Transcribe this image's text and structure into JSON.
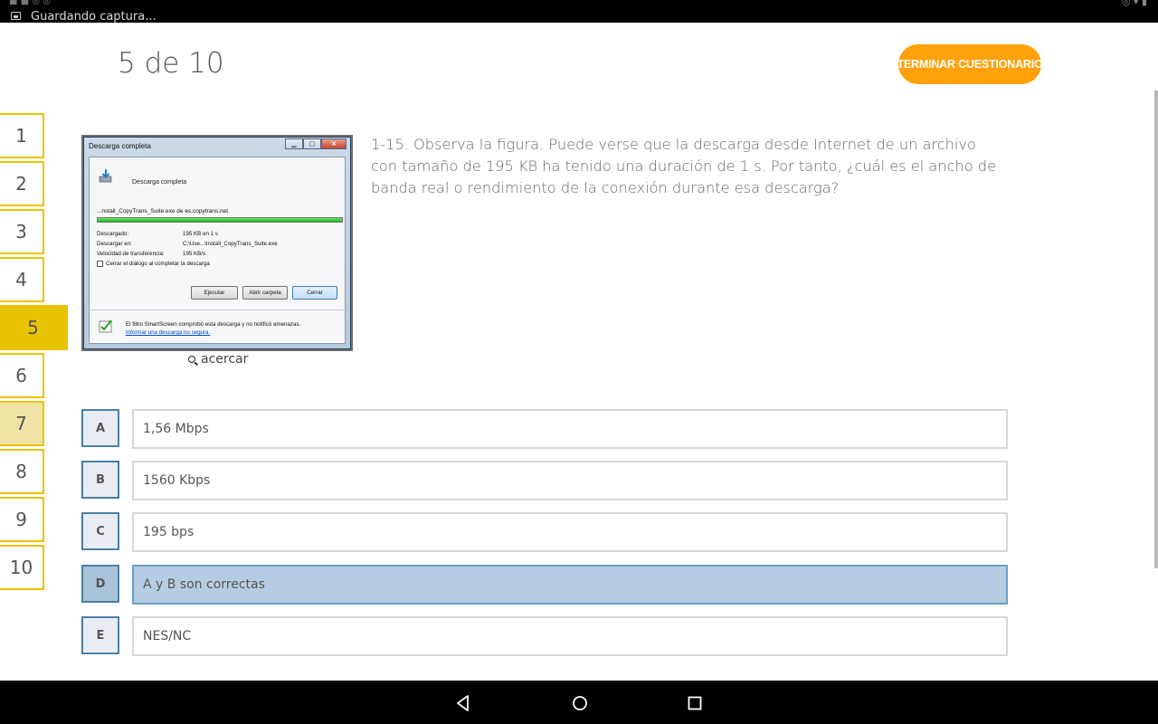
{
  "status_bar": {
    "notification_text": "Guardando captura..."
  },
  "header": {
    "counter": "5 de 10",
    "finish_button": "TERMINAR CUESTIONARIO",
    "accent_color": "#ffa10a"
  },
  "question_nav": {
    "items": [
      {
        "label": "1",
        "state": "default"
      },
      {
        "label": "2",
        "state": "default"
      },
      {
        "label": "3",
        "state": "default"
      },
      {
        "label": "4",
        "state": "default"
      },
      {
        "label": "5",
        "state": "current"
      },
      {
        "label": "6",
        "state": "default"
      },
      {
        "label": "7",
        "state": "answered"
      },
      {
        "label": "8",
        "state": "default"
      },
      {
        "label": "9",
        "state": "default"
      },
      {
        "label": "10",
        "state": "default"
      }
    ],
    "border_color": "#e8c300"
  },
  "figure": {
    "window_title": "Descarga completa",
    "heading": "Descarga completa",
    "file_name": "...nstall_CopyTrans_Suite.exe de es.copytrans.net",
    "progress": 1.0,
    "rows": [
      {
        "k": "Descargado:",
        "v": "195 KB en 1 s"
      },
      {
        "k": "Descargar en:",
        "v": "C:\\Use...\\Install_CopyTrans_Suite.exe"
      },
      {
        "k": "Velocidad de transferencia:",
        "v": "195 KB/s"
      }
    ],
    "checkbox_label": "Cerrar el diálogo al completar la descarga",
    "buttons": {
      "run": "Ejecutar",
      "open_folder": "Abrir carpeta",
      "close": "Cerrar"
    },
    "smartscreen_text": "El filtro SmartScreen comprobó esta descarga y no notificó amenazas.",
    "smartscreen_link": "Informar una descarga no segura."
  },
  "zoom_label": "acercar",
  "question_text": "1-15. Observa la figura. Puede verse que la descarga desde Internet de un archivo con tamaño de 195 KB ha tenido una duración de 1 s. Por tanto, ¿cuál es el ancho de banda real o rendimiento de la conexión durante esa descarga?",
  "options": [
    {
      "letter": "A",
      "text": "1,56 Mbps",
      "selected": false
    },
    {
      "letter": "B",
      "text": "1560 Kbps",
      "selected": false
    },
    {
      "letter": "C",
      "text": "195 bps",
      "selected": false
    },
    {
      "letter": "D",
      "text": "A y B son correctas",
      "selected": true
    },
    {
      "letter": "E",
      "text": "NES/NC",
      "selected": false
    }
  ],
  "nav_bar": {
    "icons": [
      "back-icon",
      "home-icon",
      "recents-icon"
    ]
  }
}
